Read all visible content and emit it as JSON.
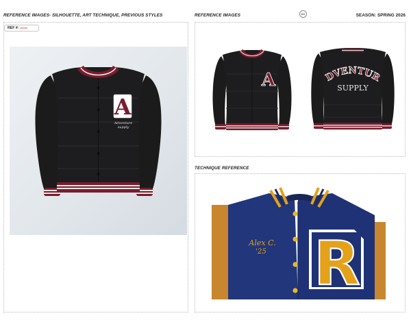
{
  "header": {
    "left_title": "REFERENCE IMAGES- SILHOUETTE, ART TECHNIQUE, PREVIOUS STYLES",
    "center_title": "REFERENCE IMAGES",
    "season": "SEASON: SPRING 2026",
    "logo_text": "BS"
  },
  "ref": {
    "label": "REF #:",
    "value": "#####"
  },
  "sections": {
    "technique_title": "TECHNIQUE REFERENCE"
  },
  "main_jacket": {
    "patch_letter": "A",
    "script_line1": "Adventure",
    "script_line2": "supply"
  },
  "back_jacket": {
    "arch_text": "ADVENTURE",
    "supply_text": "SUPPLY"
  },
  "technique": {
    "patch_letter": "R",
    "script_name": "Alex C.",
    "script_year": "'25"
  },
  "colors": {
    "jacket_black": "#1b1b1c",
    "maroon": "#7a1c2c",
    "navy": "#21357a",
    "gold": "#e3a21a",
    "sleeve_tan": "#c8862e"
  }
}
